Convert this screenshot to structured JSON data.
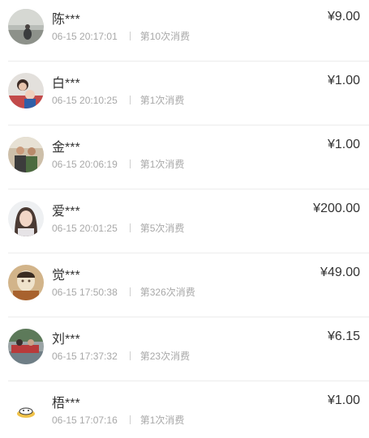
{
  "currency_symbol": "¥",
  "orders": [
    {
      "name": "陈***",
      "time": "06-15 20:17:01",
      "count": "第10次消费",
      "amount": "9.00"
    },
    {
      "name": "白***",
      "time": "06-15 20:10:25",
      "count": "第1次消费",
      "amount": "1.00"
    },
    {
      "name": "金***",
      "time": "06-15 20:06:19",
      "count": "第1次消费",
      "amount": "1.00"
    },
    {
      "name": "爱***",
      "time": "06-15 20:01:25",
      "count": "第5次消费",
      "amount": "200.00"
    },
    {
      "name": "觉***",
      "time": "06-15 17:50:38",
      "count": "第326次消费",
      "amount": "49.00"
    },
    {
      "name": "刘***",
      "time": "06-15 17:37:32",
      "count": "第23次消费",
      "amount": "6.15"
    },
    {
      "name": "梧***",
      "time": "06-15 17:07:16",
      "count": "第1次消费",
      "amount": "1.00"
    }
  ]
}
